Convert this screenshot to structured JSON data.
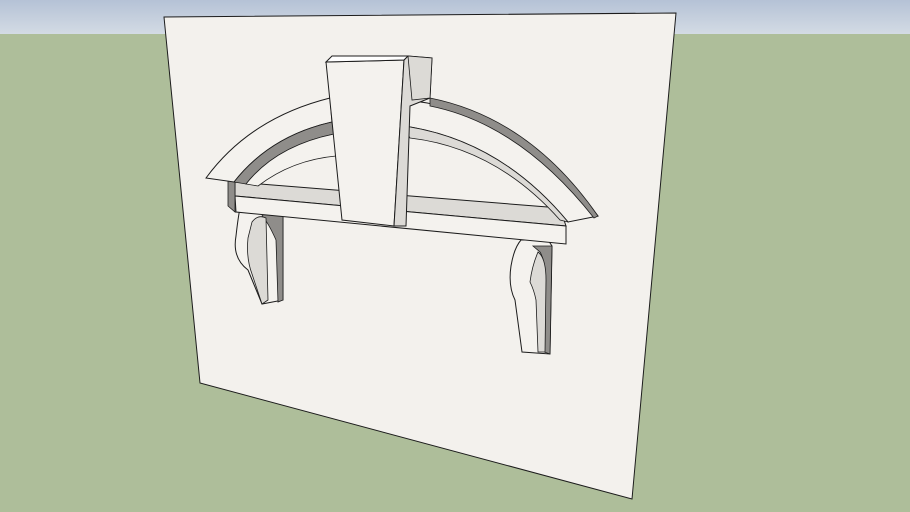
{
  "viewport": {
    "description_free": true
  },
  "colors": {
    "sky_top": "#b5c2d6",
    "sky_bottom": "#d3dbe4",
    "ground": "#aebe9a",
    "panel_face": "#f3f1ed",
    "model_light": "#f4f2ee",
    "model_mid": "#dcdad6",
    "model_shadow": "#8f8d8a",
    "edge": "#1c1c1c"
  }
}
